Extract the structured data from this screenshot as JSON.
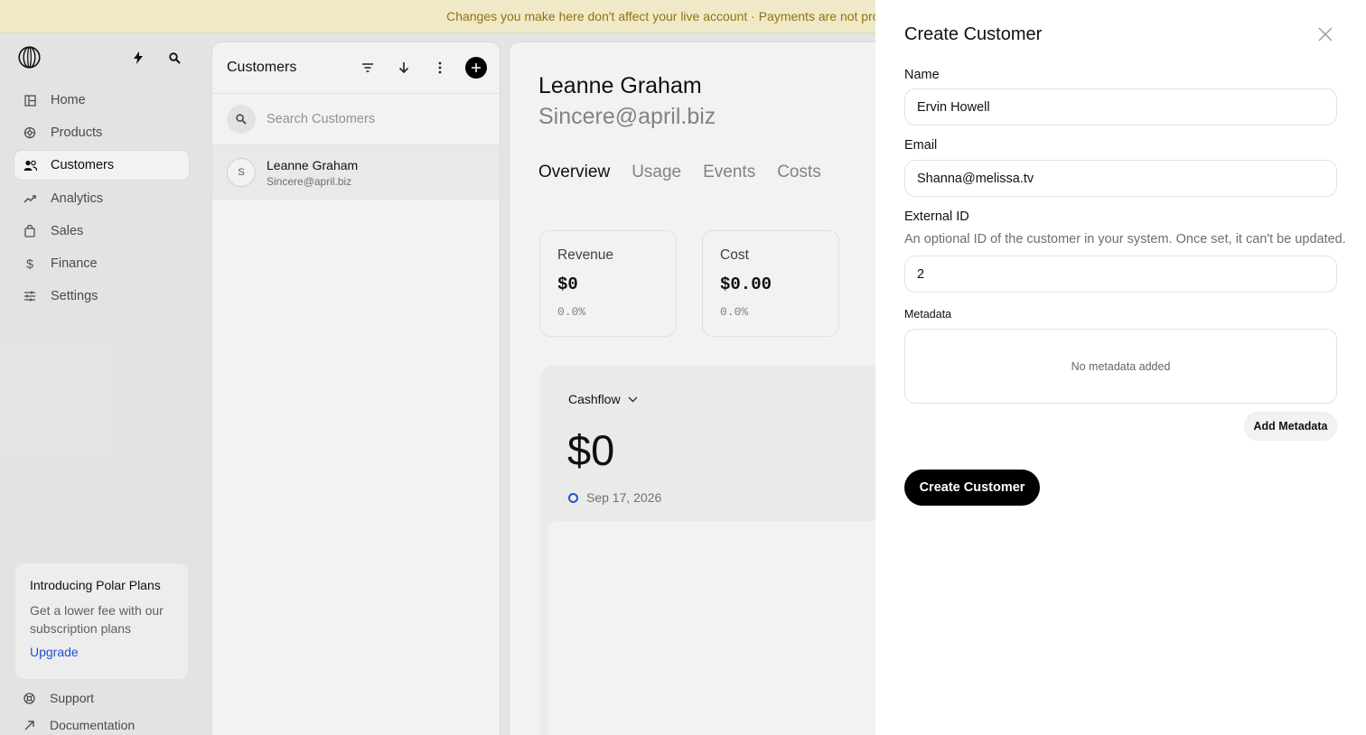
{
  "banner": {
    "text": "Changes you make here don't affect your live account · Payments are not processed"
  },
  "sidebar": {
    "logo_icon": "polar-logo-icon",
    "items": [
      {
        "label": "Home",
        "icon": "home-icon",
        "active": false
      },
      {
        "label": "Products",
        "icon": "products-icon",
        "active": false
      },
      {
        "label": "Customers",
        "icon": "customers-icon",
        "active": true
      },
      {
        "label": "Analytics",
        "icon": "analytics-icon",
        "active": false
      },
      {
        "label": "Sales",
        "icon": "sales-icon",
        "active": false
      },
      {
        "label": "Finance",
        "icon": "finance-icon",
        "active": false
      },
      {
        "label": "Settings",
        "icon": "settings-icon",
        "active": false
      }
    ],
    "promo": {
      "title": "Introducing Polar Plans",
      "text": "Get a lower fee with our subscription plans",
      "link": "Upgrade"
    },
    "support": "Support",
    "documentation": "Documentation"
  },
  "customer_list": {
    "title": "Customers",
    "search_placeholder": "Search Customers",
    "items": [
      {
        "avatar": "S",
        "name": "Leanne Graham",
        "email": "Sincere@april.biz"
      }
    ]
  },
  "detail": {
    "name": "Leanne Graham",
    "email": "Sincere@april.biz",
    "tabs": [
      "Overview",
      "Usage",
      "Events",
      "Costs"
    ],
    "active_tab": "Overview",
    "metrics": [
      {
        "label": "Revenue",
        "value": "$0",
        "pct": "0.0%"
      },
      {
        "label": "Cost",
        "value": "$0.00",
        "pct": "0.0%"
      }
    ],
    "cashflow": {
      "title": "Cashflow",
      "value": "$0",
      "date": "Sep 17, 2026"
    }
  },
  "drawer": {
    "title": "Create Customer",
    "name_label": "Name",
    "name_value": "Ervin Howell",
    "email_label": "Email",
    "email_value": "Shanna@melissa.tv",
    "external_id_label": "External ID",
    "external_id_help": "An optional ID of the customer in your system. Once set, it can't be updated.",
    "external_id_value": "2",
    "metadata_label": "Metadata",
    "metadata_empty": "No metadata added",
    "add_metadata_label": "Add Metadata",
    "create_label": "Create Customer"
  },
  "colors": {
    "accent": "#2954e0",
    "banner_text": "#9a7a13",
    "primary_button": "#000000"
  }
}
